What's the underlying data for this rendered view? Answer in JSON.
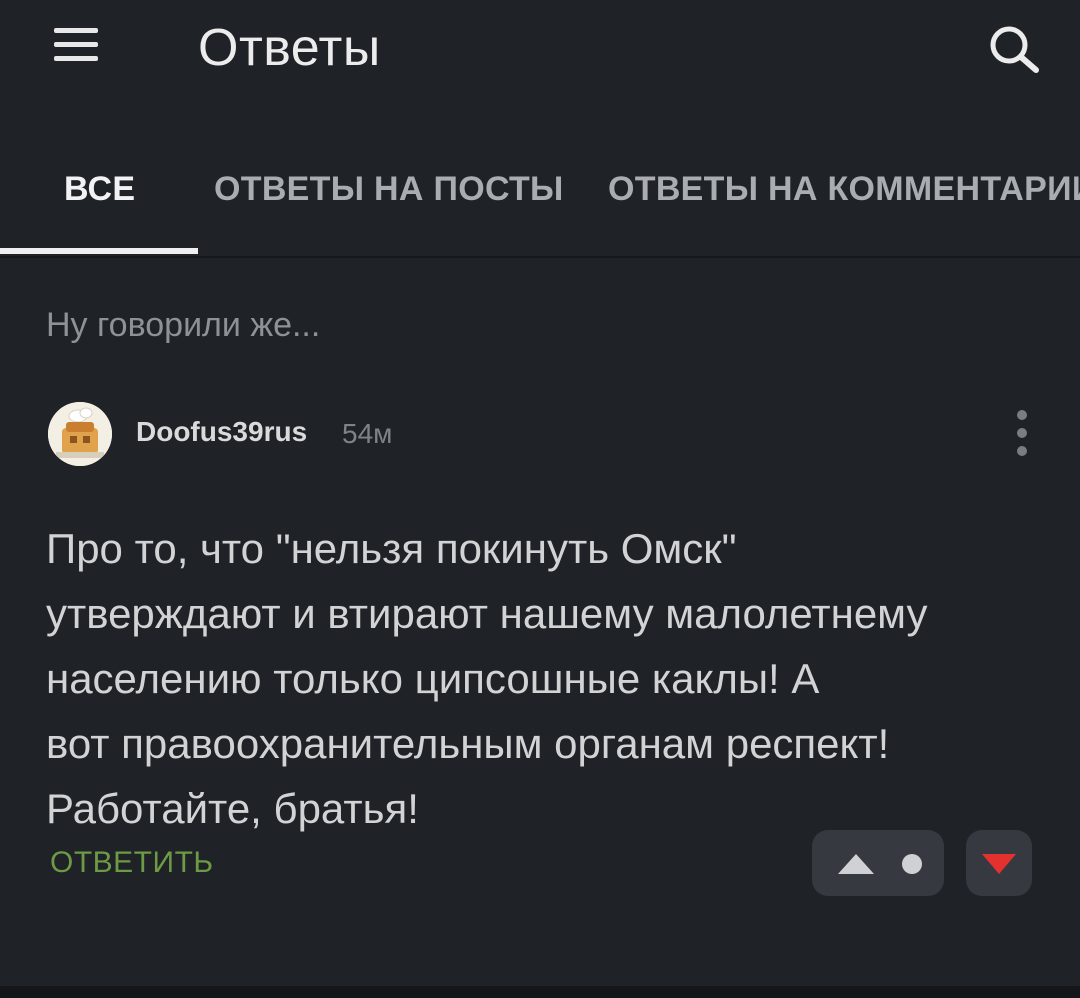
{
  "header": {
    "title": "Ответы",
    "menu_icon": "hamburger-menu-icon",
    "search_icon": "search-icon"
  },
  "tabs": [
    {
      "label": "ВСЕ",
      "active": true
    },
    {
      "label": "ОТВЕТЫ НА ПОСТЫ",
      "active": false
    },
    {
      "label": "ОТВЕТЫ НА КОММЕНТАРИИ",
      "active": false
    }
  ],
  "post": {
    "title": "Ну говорили же..."
  },
  "comment": {
    "username": "Doofus39rus",
    "time": "54м",
    "text": "Про то, что \"нельзя покинуть Омск\"\nутверждают и втирают нашему малолетнему\nнаселению только ципсошные каклы! А\nвот правоохранительным органам респект!\nРаботайте, братья!",
    "reply_label": "ОТВЕТИТЬ",
    "more_icon": "more-vertical-icon"
  },
  "colors": {
    "background": "#1f2226",
    "accent_reply": "#6d9a45",
    "downvote": "#e2312f",
    "button_bg": "#363a40"
  }
}
